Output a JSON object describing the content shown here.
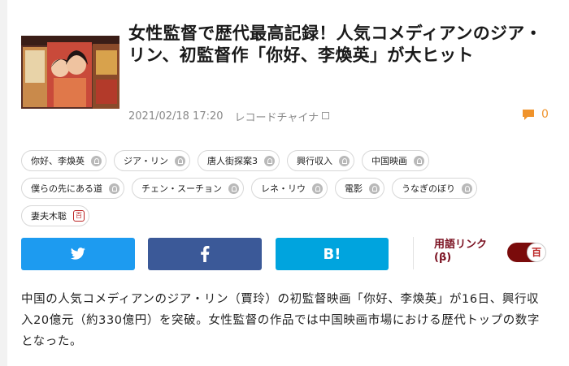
{
  "article": {
    "title": "女性監督で歴代最高記録！人気コメディアンのジア・リン、初監督作「你好、李煥英」が大ヒット",
    "date": "2021/02/18 17:20",
    "source": "レコードチャイナ",
    "comment_count": "0",
    "body": "中国の人気コメディアンのジア・リン（賈玲）の初監督映画「你好、李煥英」が16日、興行収入20億元（約330億円）を突破。女性監督の作品では中国映画市場における歴代トップの数字となった。"
  },
  "tags": [
    [
      "你好、李煥英",
      "ジア・リン",
      "唐人街探案3",
      "興行収入",
      "中国映画"
    ],
    [
      "僕らの先にある道",
      "チェン・スーチョン",
      "レネ・リウ",
      "電影",
      "うなぎのぼり"
    ],
    [
      "妻夫木聡"
    ]
  ],
  "share": {
    "hatena_label": "B!",
    "glossary_label": "用語リンク",
    "glossary_beta": "(β)",
    "toggle_label": "百"
  },
  "colors": {
    "twitter": "#1d9bf0",
    "facebook": "#3b5998",
    "hatena": "#00a4de",
    "accent": "#f0932b",
    "glossary": "#7a1020"
  }
}
